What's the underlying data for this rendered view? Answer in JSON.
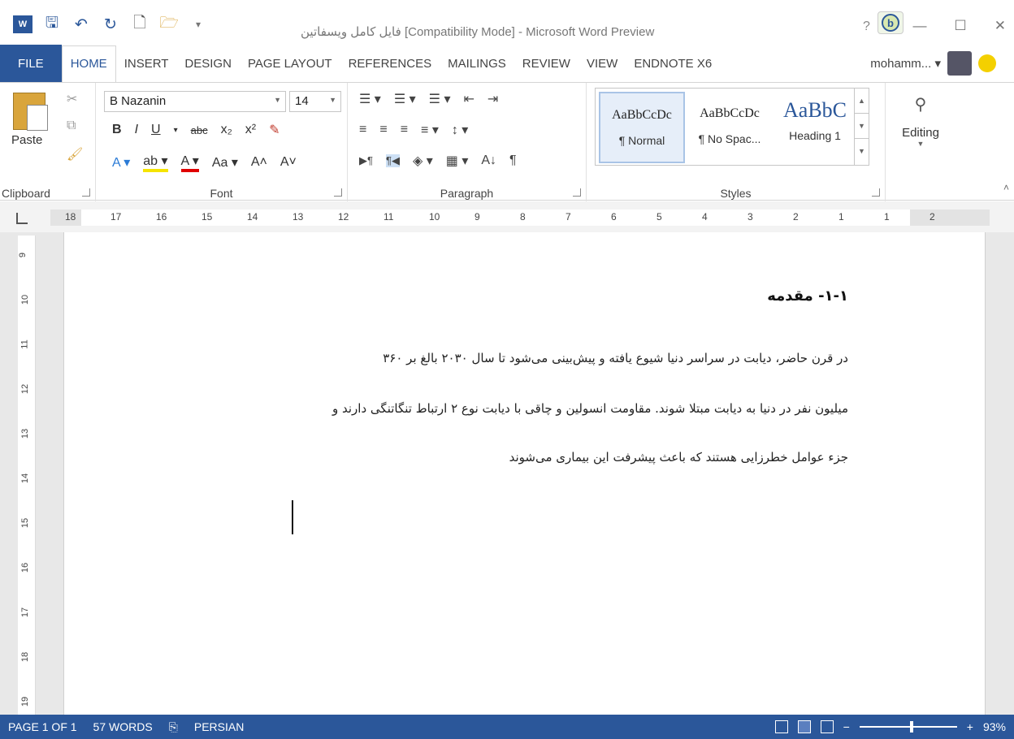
{
  "window": {
    "title": "فایل کامل ویسفاتین [Compatibility Mode] - Microsoft Word Preview",
    "help": "?",
    "bing": "b"
  },
  "tabs": [
    "FILE",
    "HOME",
    "INSERT",
    "DESIGN",
    "PAGE LAYOUT",
    "REFERENCES",
    "MAILINGS",
    "REVIEW",
    "VIEW",
    "ENDNOTE X6"
  ],
  "user": {
    "name": "mohamm... ▾"
  },
  "ribbon": {
    "clipboard": {
      "paste": "Paste",
      "label": "Clipboard"
    },
    "font": {
      "family": "B Nazanin",
      "size": "14",
      "label": "Font",
      "row1": [
        "B",
        "I",
        "U",
        "▾",
        "abc",
        "x₂",
        "x²",
        "✎"
      ],
      "row2": [
        "A ▾",
        "ab ▾",
        "A ▾",
        "Aa ▾",
        "A˄",
        "A˅"
      ]
    },
    "paragraph": {
      "label": "Paragraph",
      "row1": [
        "☰ ▾",
        "☰ ▾",
        "☰ ▾",
        "⇤",
        "⇥"
      ],
      "row2": [
        "≡",
        "≡",
        "≡",
        "≡ ▾",
        "↕ ▾"
      ],
      "row3": [
        "▶¶",
        "¶◀",
        "◈ ▾",
        "▦ ▾",
        "A↓",
        "¶"
      ]
    },
    "styles": {
      "label": "Styles",
      "items": [
        {
          "preview": "AaBbCcDc",
          "name": "¶ Normal"
        },
        {
          "preview": "AaBbCcDc",
          "name": "¶ No Spac..."
        },
        {
          "preview": "AaBbC",
          "name": "Heading 1"
        }
      ]
    },
    "editing": {
      "label": "Editing"
    }
  },
  "ruler": {
    "numbers": [
      "18",
      "17",
      "16",
      "15",
      "14",
      "13",
      "12",
      "11",
      "10",
      "9",
      "8",
      "7",
      "6",
      "5",
      "4",
      "3",
      "2",
      "1",
      "1",
      "2"
    ]
  },
  "vruler": {
    "numbers": [
      "9",
      "10",
      "11",
      "12",
      "13",
      "14",
      "15",
      "16",
      "17",
      "18",
      "19"
    ]
  },
  "document": {
    "heading": "۱-۱- مقدمه",
    "lines": [
      "در قرن حاضر، دیابت در سراسر دنیا شیوع یافته و پیش‌بینی می‌شود تا سال ۲۰۳۰ بالغ بر ۳۶۰",
      "میلیون نفر در دنیا به دیابت مبتلا شوند. مقاومت انسولین و چاقی با دیابت نوع ۲ ارتباط تنگاتنگی دارند و",
      "جزء عوامل خطرزایی هستند که باعث پیشرفت این بیماری می‌شوند"
    ]
  },
  "status": {
    "page": "PAGE 1 OF 1",
    "words": "57 WORDS",
    "lang": "PERSIAN",
    "zoom": "93%"
  }
}
